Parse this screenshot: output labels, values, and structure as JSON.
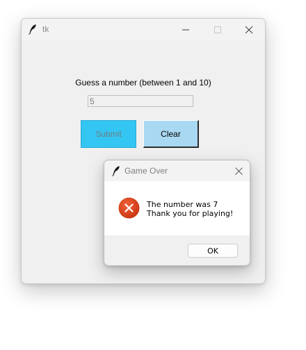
{
  "main_window": {
    "title": "tk",
    "icon": "feather-icon",
    "controls": [
      "minimize-icon",
      "maximize-icon",
      "close-icon"
    ],
    "prompt": "Guess a number (between 1 and 10)",
    "guess_input": {
      "value": "5"
    },
    "submit_button": {
      "label": "Submit",
      "color": "#34c6f3"
    },
    "clear_button": {
      "label": "Clear",
      "color": "#a9d8f2"
    }
  },
  "dialog": {
    "title": "Game Over",
    "icon": "feather-icon",
    "status_icon": "error-icon",
    "status_color": "#e0401c",
    "message_line_1": "The number was 7",
    "message_line_2": "Thank you for playing!",
    "ok_button": {
      "label": "OK"
    }
  }
}
